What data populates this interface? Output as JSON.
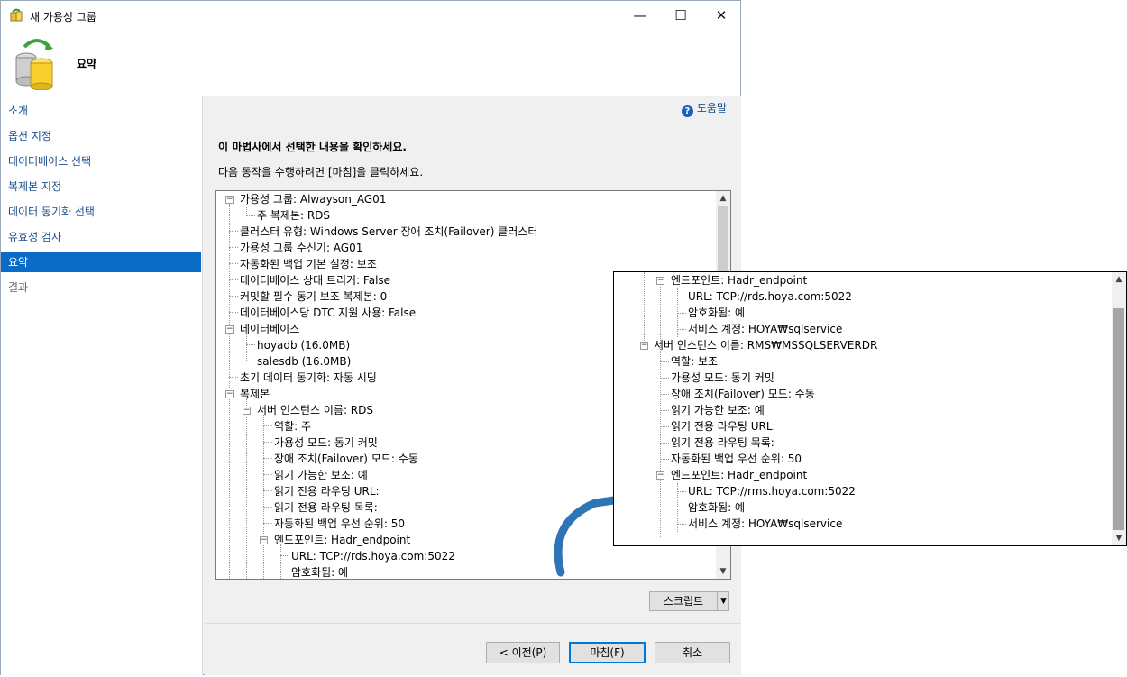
{
  "window": {
    "title": "새 가용성 그룹",
    "minimize_icon": "minimize-icon",
    "maximize_icon": "maximize-icon",
    "close_icon": "close-icon"
  },
  "header": {
    "title": "요약"
  },
  "sidebar": {
    "items": [
      {
        "label": "소개",
        "state": "link"
      },
      {
        "label": "옵션 지정",
        "state": "link"
      },
      {
        "label": "데이터베이스 선택",
        "state": "link"
      },
      {
        "label": "복제본 지정",
        "state": "link"
      },
      {
        "label": "데이터 동기화 선택",
        "state": "link"
      },
      {
        "label": "유효성 검사",
        "state": "link"
      },
      {
        "label": "요약",
        "state": "active"
      },
      {
        "label": "결과",
        "state": "disabled"
      }
    ]
  },
  "main": {
    "help_label": "도움말",
    "heading": "이 마법사에서 선택한 내용을 확인하세요.",
    "instruction": "다음 동작을 수행하려면 [마침]을 클릭하세요.",
    "tree": [
      {
        "text": "가용성 그룹: Alwayson_AG01"
      },
      {
        "text": "주 복제본: RDS"
      },
      {
        "text": "클러스터 유형: Windows Server 장애 조치(Failover) 클러스터"
      },
      {
        "text": "가용성 그룹 수신기: AG01"
      },
      {
        "text": "자동화된 백업 기본 설정: 보조"
      },
      {
        "text": "데이터베이스 상태 트리거: False"
      },
      {
        "text": "커밋할 필수 동기 보조 복제본: 0"
      },
      {
        "text": "데이터베이스당 DTC 지원 사용: False"
      },
      {
        "text": "데이터베이스"
      },
      {
        "text": "hoyadb (16.0MB)"
      },
      {
        "text": "salesdb (16.0MB)"
      },
      {
        "text": "초기 데이터 동기화: 자동 시딩"
      },
      {
        "text": "복제본"
      },
      {
        "text": "서버 인스턴스 이름: RDS"
      },
      {
        "text": "역할: 주"
      },
      {
        "text": "가용성 모드: 동기 커밋"
      },
      {
        "text": "장애 조치(Failover) 모드: 수동"
      },
      {
        "text": "읽기 가능한 보조: 예"
      },
      {
        "text": "읽기 전용 라우팅 URL:"
      },
      {
        "text": "읽기 전용 라우팅 목록:"
      },
      {
        "text": "자동화된 백업 우선 순위: 50"
      },
      {
        "text": "엔드포인트: Hadr_endpoint"
      },
      {
        "text": "URL: TCP://rds.hoya.com:5022"
      },
      {
        "text": "암호화됨: 예"
      }
    ],
    "scroll_fraction": 0.0,
    "script_button": "스크립트",
    "buttons": {
      "prev": "< 이전(P)",
      "finish": "마침(F)",
      "cancel": "취소"
    }
  },
  "zoom_panel": {
    "tree": [
      {
        "text": "엔드포인트: Hadr_endpoint"
      },
      {
        "text": "URL: TCP://rds.hoya.com:5022"
      },
      {
        "text": "암호화됨: 예"
      },
      {
        "text": "서비스 계정: HOYA₩sqlservice"
      },
      {
        "text": "서버 인스턴스 이름: RMS₩MSSQLSERVERDR"
      },
      {
        "text": "역할: 보조"
      },
      {
        "text": "가용성 모드: 동기 커밋"
      },
      {
        "text": "장애 조치(Failover) 모드: 수동"
      },
      {
        "text": "읽기 가능한 보조: 예"
      },
      {
        "text": "읽기 전용 라우팅 URL:"
      },
      {
        "text": "읽기 전용 라우팅 목록:"
      },
      {
        "text": "자동화된 백업 우선 순위: 50"
      },
      {
        "text": "엔드포인트: Hadr_endpoint"
      },
      {
        "text": "URL: TCP://rms.hoya.com:5022"
      },
      {
        "text": "암호화됨: 예"
      },
      {
        "text": "서비스 계정: HOYA₩sqlservice"
      }
    ],
    "scroll_fraction": 1.0
  },
  "colors": {
    "accent": "#0a6cc7",
    "link": "#1c4f8f",
    "arrow": "#2e75b6"
  }
}
